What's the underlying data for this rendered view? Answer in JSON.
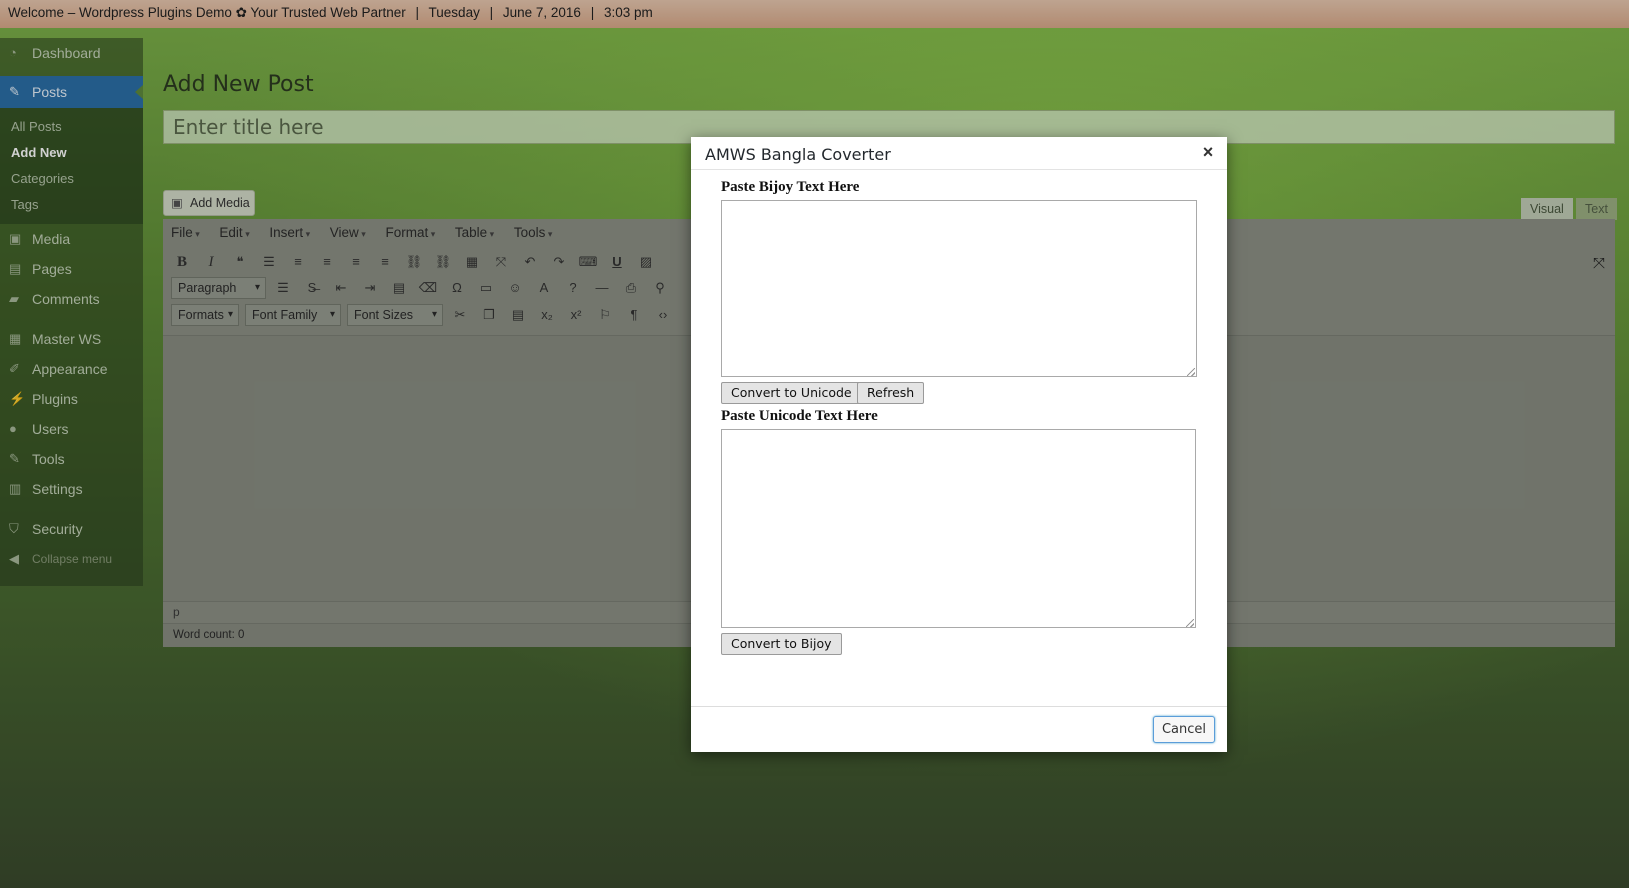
{
  "topbar": {
    "site": "Welcome – Wordpress Plugins Demo ✿ Your Trusted Web Partner",
    "day": "Tuesday",
    "date": "June 7, 2016",
    "time": "3:03 pm",
    "separator": "|"
  },
  "sidebar": {
    "dashboard": "Dashboard",
    "posts": "Posts",
    "sub": {
      "all_posts": "All Posts",
      "add_new": "Add New",
      "categories": "Categories",
      "tags": "Tags"
    },
    "media": "Media",
    "pages": "Pages",
    "comments": "Comments",
    "master_ws": "Master WS",
    "appearance": "Appearance",
    "plugins": "Plugins",
    "users": "Users",
    "tools": "Tools",
    "settings": "Settings",
    "security": "Security",
    "collapse": "Collapse menu"
  },
  "editor": {
    "page_title": "Add New Post",
    "title_placeholder": "Enter title here",
    "add_media": "Add Media",
    "tab_visual": "Visual",
    "tab_text": "Text",
    "menu": [
      "File",
      "Edit",
      "Insert",
      "View",
      "Format",
      "Table",
      "Tools"
    ],
    "paragraph_select": "Paragraph",
    "formats_select": "Formats",
    "font_family_select": "Font Family",
    "font_sizes_select": "Font Sizes",
    "path": "p",
    "word_count": "Word count: 0"
  },
  "modal": {
    "title": "AMWS Bangla Coverter",
    "close": "×",
    "bijoy_label": "Paste Bijoy Text Here",
    "bijoy_value": "",
    "convert_unicode": "Convert to Unicode",
    "refresh": "Refresh",
    "unicode_label": "Paste Unicode Text Here",
    "unicode_value": "",
    "convert_bijoy": "Convert to Bijoy",
    "cancel": "Cancel"
  }
}
